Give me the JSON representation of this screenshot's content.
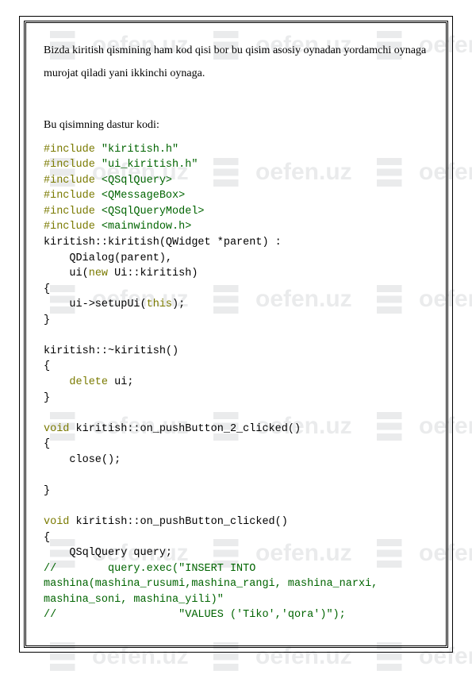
{
  "watermark": "oefen.uz",
  "para1": "Bizda kiritish qismining ham kod qisi bor bu qisim asosiy oynadan yordamchi oynaga murojat qiladi yani ikkinchi oynaga.",
  "para2": "Bu qisimning dastur kodi:",
  "code": {
    "l1_a": "#include",
    "l1_b": " \"kiritish.h\"",
    "l2_a": "#include",
    "l2_b": " \"ui_kiritish.h\"",
    "l3_a": "#include",
    "l3_b": " <QSqlQuery>",
    "l4_a": "#include",
    "l4_b": " <QMessageBox>",
    "l5_a": "#include",
    "l5_b": " <QSqlQueryModel>",
    "l6_a": "#include",
    "l6_b": " <mainwindow.h>",
    "l7": "kiritish::kiritish(QWidget *parent) :",
    "l8": "    QDialog(parent),",
    "l9_a": "    ui(",
    "l9_b": "new",
    "l9_c": " Ui::kiritish)",
    "l10": "{",
    "l11_a": "    ui->setupUi(",
    "l11_b": "this",
    "l11_c": ");",
    "l12": "}",
    "l13": "kiritish::~kiritish()",
    "l14": "{",
    "l15_a": "    ",
    "l15_b": "delete",
    "l15_c": " ui;",
    "l16": "}",
    "l17_a": "void",
    "l17_b": " kiritish::on_pushButton_2_clicked()",
    "l18": "{",
    "l19": "    close();",
    "l20": "}",
    "l21_a": "void",
    "l21_b": " kiritish::on_pushButton_clicked()",
    "l22": "{",
    "l23": "    QSqlQuery query;",
    "l24": "//        query.exec(\"INSERT INTO mashina(mashina_rusumi,mashina_rangi, mashina_narxi, mashina_soni, mashina_yili)\"",
    "l25": "//                   \"VALUES ('Tiko','qora')\");"
  }
}
